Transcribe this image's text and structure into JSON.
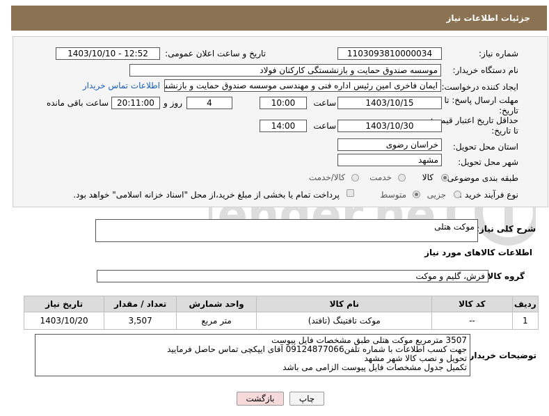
{
  "header": {
    "title": "جزئیات اطلاعات نیاز"
  },
  "form": {
    "need_number": {
      "label": "شماره نیاز:",
      "value": "1103093810000034"
    },
    "announce_datetime": {
      "label": "تاریخ و ساعت اعلان عمومی:",
      "value": "1403/10/10 - 12:52"
    },
    "buyer_org": {
      "label": "نام دستگاه خریدار:",
      "value": "موسسه صندوق حمایت و بازنشستگی کارکنان فولاد"
    },
    "requester": {
      "label": "ایجاد کننده درخواست:",
      "value": "ایمان فاخری امین رئیس اداره فنی و مهندسی موسسه صندوق حمایت و بازنشستگی",
      "contact_link": "اطلاعات تماس خریدار"
    },
    "deadline": {
      "label": "مهلت ارسال پاسخ: تا تاریخ:",
      "date": "1403/10/15",
      "time_label": "ساعت",
      "time": "10:00",
      "days": "4",
      "days_label": "روز و",
      "remaining": "20:11:00",
      "remaining_label": "ساعت باقی مانده"
    },
    "validity": {
      "label": "حداقل تاریخ اعتبار قیمت: تا تاریخ:",
      "date": "1403/10/30",
      "time_label": "ساعت",
      "time": "14:00"
    },
    "province": {
      "label": "استان محل تحویل:",
      "value": "خراسان رضوی"
    },
    "city": {
      "label": "شهر محل تحویل:",
      "value": "مشهد"
    },
    "category": {
      "label": "طبقه بندی موضوعی:",
      "options": [
        "کالا",
        "خدمت",
        "کالا/خدمت"
      ],
      "selected": 0
    },
    "process": {
      "label": "نوع فرآیند خرید :",
      "options": [
        "جزیی",
        "متوسط"
      ],
      "selected": 1,
      "checkbox_text": "پرداخت تمام یا بخشی از مبلغ خرید،از محل \"اسناد خزانه اسلامی\" خواهد بود."
    }
  },
  "summary": {
    "label": "شرح کلی نیاز:",
    "value": "موکت هتلی"
  },
  "goods_info_title": "اطلاعات کالاهای مورد نیاز",
  "goods_group": {
    "label": "گروه کالا:",
    "value": "فرش، گلیم و موکت"
  },
  "table": {
    "headers": [
      "ردیف",
      "کد کالا",
      "نام کالا",
      "واحد شمارش",
      "تعداد / مقدار",
      "تاریخ نیاز"
    ],
    "rows": [
      [
        "1",
        "--",
        "موکت تافتینگ (تافتد)",
        "متر مربع",
        "3,507",
        "1403/10/20"
      ]
    ]
  },
  "buyer_notes": {
    "label": "توضیحات خریدار:",
    "lines": [
      "3507 مترمربع موکت هتلی طبق مشخصات فایل پیوست",
      "جهت کسب اطلاعات با شماره تلفن09124877066 آقای ایپکچی تماس حاصل فرمایید",
      "تحویل و نصب کالا شهر مشهد",
      "تکمیل جدول مشخصات فایل پیوست الزامی می باشد"
    ]
  },
  "buttons": {
    "print": "چاپ",
    "back": "بازگشت"
  },
  "colors": {
    "header_bg": "#8a7253",
    "link": "#1a5fb4",
    "back_bg": "#f6dada"
  },
  "watermark": {
    "text": "AriaTender.neT"
  }
}
